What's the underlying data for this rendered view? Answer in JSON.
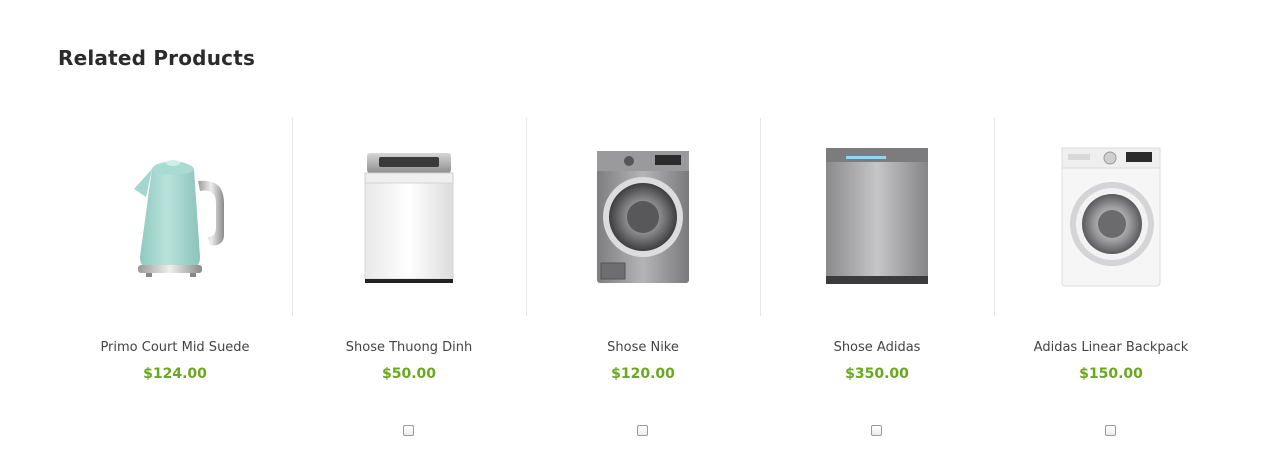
{
  "section": {
    "title": "Related Products"
  },
  "colors": {
    "price": "#6aa81e",
    "title": "#2b2b2b",
    "name": "#444444"
  },
  "products": [
    {
      "name": "Primo Court Mid Suede",
      "price": "$124.00",
      "image": "kettle-image",
      "compare_checkbox": false
    },
    {
      "name": "Shose Thuong Dinh",
      "price": "$50.00",
      "image": "top-load-washer-image",
      "compare_checkbox": true
    },
    {
      "name": "Shose Nike",
      "price": "$120.00",
      "image": "front-load-washer-silver-image",
      "compare_checkbox": true
    },
    {
      "name": "Shose Adidas",
      "price": "$350.00",
      "image": "dishwasher-image",
      "compare_checkbox": true
    },
    {
      "name": "Adidas Linear Backpack",
      "price": "$150.00",
      "image": "front-load-washer-white-image",
      "compare_checkbox": true
    }
  ]
}
